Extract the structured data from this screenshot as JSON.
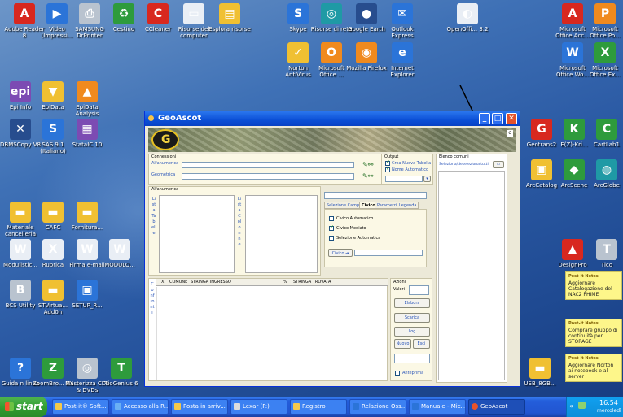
{
  "desktop_icons": [
    {
      "label": "Adobe Reader 8",
      "icon": "adobe-reader-icon"
    },
    {
      "label": "Video (Impressi...",
      "icon": "video-folder-icon"
    },
    {
      "label": "SAMSUNG DrPrinter",
      "icon": "printer-icon"
    },
    {
      "label": "Cestino",
      "icon": "recycle-bin-icon"
    },
    {
      "label": "CCleaner",
      "icon": "ccleaner-icon"
    },
    {
      "label": "Risorse del computer",
      "icon": "my-computer-icon"
    },
    {
      "label": "Esplora risorse",
      "icon": "explorer-icon"
    },
    {
      "label": "Skype",
      "icon": "skype-icon"
    },
    {
      "label": "Risorse di rete",
      "icon": "network-icon"
    },
    {
      "label": "Google Earth",
      "icon": "google-earth-icon"
    },
    {
      "label": "Outlook Express",
      "icon": "outlook-icon"
    },
    {
      "label": "OpenOffi... 3.2",
      "icon": "openoffice-icon"
    },
    {
      "label": "Microsoft Office Acc...",
      "icon": "access-icon"
    },
    {
      "label": "Microsoft Office Po...",
      "icon": "powerpoint-icon"
    },
    {
      "label": "Norton AntiVirus",
      "icon": "norton-icon"
    },
    {
      "label": "Microsoft Office ...",
      "icon": "office-icon"
    },
    {
      "label": "Mozilla Firefox",
      "icon": "firefox-icon"
    },
    {
      "label": "Internet Explorer",
      "icon": "ie-icon"
    },
    {
      "label": "Microsoft Office Wo...",
      "icon": "word-icon"
    },
    {
      "label": "Microsoft Office Ex...",
      "icon": "excel-icon"
    },
    {
      "label": "Epi Info",
      "icon": "epi-info-icon"
    },
    {
      "label": "EpiData",
      "icon": "epidata-icon"
    },
    {
      "label": "EpiData Analysis",
      "icon": "epidata-analysis-icon"
    },
    {
      "label": "DBMSCopy V8",
      "icon": "dbmscopy-icon"
    },
    {
      "label": "SAS 9.1 (Italiano)",
      "icon": "sas-icon"
    },
    {
      "label": "StataIC 10",
      "icon": "stata-icon"
    },
    {
      "label": "Geotrans2",
      "icon": "geotrans-icon"
    },
    {
      "label": "E(Z)-Kri...",
      "icon": "ezkri-icon"
    },
    {
      "label": "CartLab1",
      "icon": "cartlab-icon"
    },
    {
      "label": "ArcCatalog",
      "icon": "arccatalog-icon"
    },
    {
      "label": "ArcScene",
      "icon": "arcscene-icon"
    },
    {
      "label": "ArcGlobe",
      "icon": "arcglobe-icon"
    },
    {
      "label": "Materiale cancelleria",
      "icon": "folder-icon"
    },
    {
      "label": "CAFC",
      "icon": "folder-icon"
    },
    {
      "label": "Fornitura...",
      "icon": "folder-icon"
    },
    {
      "label": "Modulistic...",
      "icon": "document-icon"
    },
    {
      "label": "Rubrica",
      "icon": "document-icon"
    },
    {
      "label": "Firma e-mail",
      "icon": "document-icon"
    },
    {
      "label": "MODULO...",
      "icon": "document-icon"
    },
    {
      "label": "DesignPro",
      "icon": "designpro-icon"
    },
    {
      "label": "Tico",
      "icon": "tico-icon"
    },
    {
      "label": "BCS Utility",
      "icon": "bcs-icon"
    },
    {
      "label": "STVirtua... Add0n",
      "icon": "stvirtual-icon"
    },
    {
      "label": "SETUP_R...",
      "icon": "setup-icon"
    },
    {
      "label": "Guida n linea",
      "icon": "help-icon"
    },
    {
      "label": "ZoomBro... EX",
      "icon": "zoombrowser-icon"
    },
    {
      "label": "Masterizza CDs & DVDs",
      "icon": "cd-burner-icon"
    },
    {
      "label": "TioGenius 6",
      "icon": "tiogenius-icon"
    },
    {
      "label": "USB_8GB...",
      "icon": "usb-folder-icon"
    }
  ],
  "postits": [
    {
      "header": "Post-it Notes",
      "text": "Aggiornare Catalogazione del NAC2 PHIME"
    },
    {
      "header": "Post-it Notes",
      "text": "Comprare gruppo di continuità per STORAGE"
    },
    {
      "header": "Post-it Notes",
      "text": "Aggiornare Norton ai notebook e al server"
    }
  ],
  "window": {
    "title": "GeoAscot",
    "connessioni": {
      "section_label": "Connessioni",
      "alfanumerica_label": "Alfanumerica",
      "geometrica_label": "Geometrica",
      "alfanumerica_value": "",
      "geometrica_value": ""
    },
    "output": {
      "section_label": "Output",
      "crea_nuova_tabella": "Crea Nuova Tabella",
      "nome_automatico": "Nome Automatico"
    },
    "elenco_comuni": {
      "section_label": "Elenco comuni",
      "select_label": "Seleziona/deseleziona tutti"
    },
    "alfanumerica_section": {
      "label": "Alfanumerica",
      "lista_tabelle": "ListaTabelle",
      "lista_colonne": "ListaColonne"
    },
    "tabs": [
      "Selezione Campi",
      "Civico",
      "Parametri",
      "Legenda"
    ],
    "civico_options": [
      {
        "label": "Civico Automatico",
        "checked": false
      },
      {
        "label": "Civico Mediato",
        "checked": true
      },
      {
        "label": "Selezione Automatica",
        "checked": false
      }
    ],
    "civico_label": "Civico",
    "grid": {
      "side_label": "Confronti",
      "headers": [
        "X",
        "COMUNE",
        "STRINGA INGRESSO",
        "%",
        "STRINGA TROVATA"
      ]
    },
    "azioni": {
      "section_label": "Azioni",
      "valori_label": "Valori",
      "elabora": "Elabora",
      "scarica": "Scarica",
      "log": "Log",
      "nuovo": "Nuovo",
      "esci": "Esci",
      "anteprima": "Anteprima"
    }
  },
  "taskbar": {
    "start_label": "start",
    "tasks": [
      {
        "label": "Post-it® Soft..."
      },
      {
        "label": "Accesso alla R..."
      },
      {
        "label": "Posta in arriv..."
      },
      {
        "label": "Lexar (F:)"
      },
      {
        "label": "Registro"
      },
      {
        "label": "Relazione Oss..."
      },
      {
        "label": "Manuale - Mic..."
      },
      {
        "label": "GeoAscot"
      }
    ],
    "clock_time": "16.54",
    "clock_day": "mercoledì"
  }
}
